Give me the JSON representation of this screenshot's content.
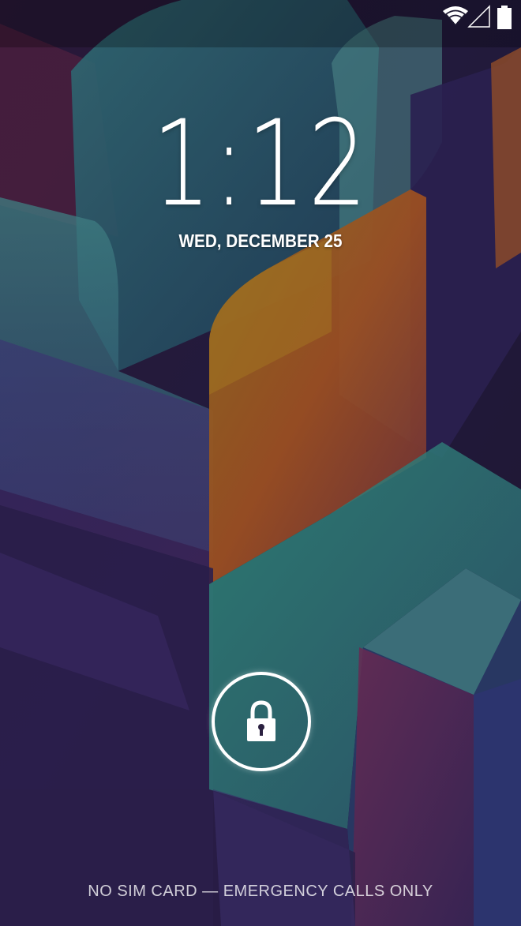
{
  "status_bar": {
    "icons": [
      "wifi-icon",
      "signal-icon",
      "battery-icon"
    ]
  },
  "lockscreen": {
    "time": "1:12",
    "date": "WED, DECEMBER 25",
    "carrier_text": "NO SIM CARD — EMERGENCY CALLS ONLY",
    "unlock_icon": "lock-icon"
  },
  "colors": {
    "text": "#ffffff",
    "background": "#1a1430"
  }
}
